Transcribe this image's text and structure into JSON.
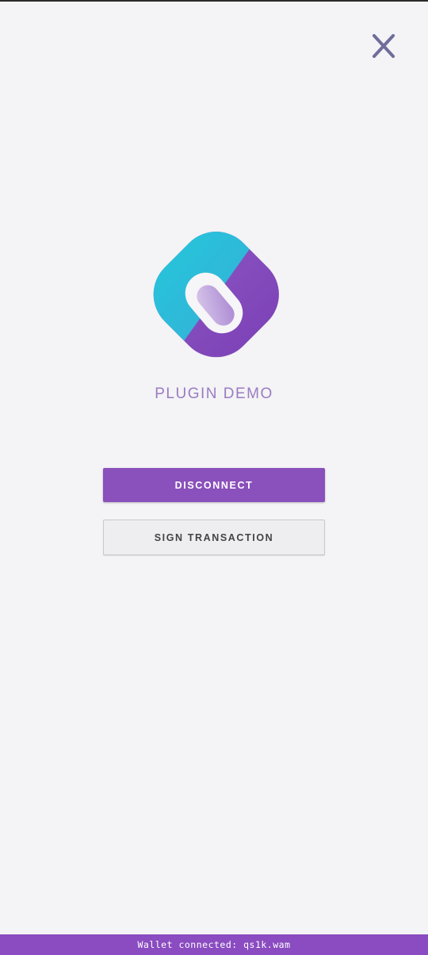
{
  "header": {
    "close_icon": "close-icon",
    "close_color": "#6f6d99"
  },
  "app": {
    "logo_icon": "plugin-logo-icon",
    "title": "PLUGIN DEMO",
    "accent": "#8a50bb",
    "teal": "#2ec6d8"
  },
  "actions": {
    "disconnect_label": "DISCONNECT",
    "sign_label": "SIGN TRANSACTION"
  },
  "status": {
    "text": "Wallet connected: qs1k.wam",
    "bar_color": "#8a4cc0"
  }
}
